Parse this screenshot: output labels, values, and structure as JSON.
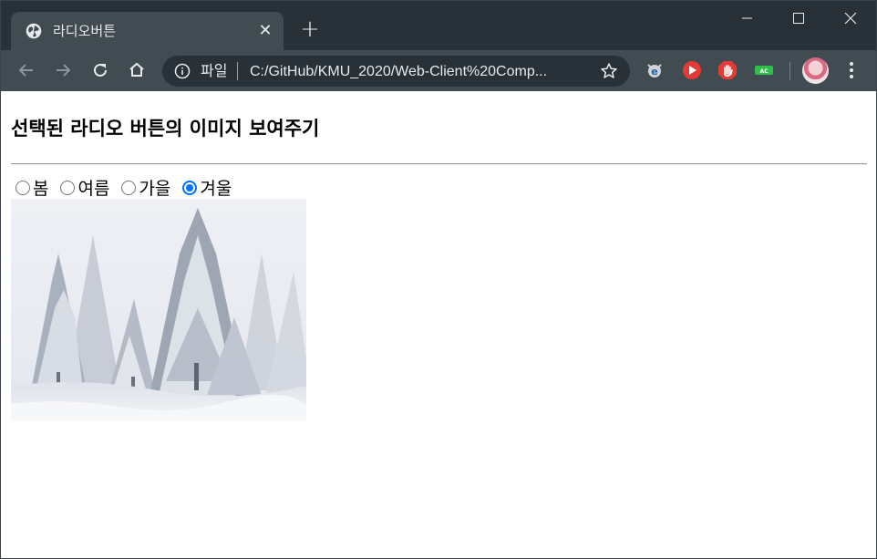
{
  "browser": {
    "tab_title": "라디오버튼",
    "scheme_label": "파일",
    "url": "C:/GitHub/KMU_2020/Web-Client%20Comp..."
  },
  "page": {
    "heading": "선택된 라디오 버튼의 이미지 보여주기",
    "radios": [
      {
        "label": "봄",
        "checked": false
      },
      {
        "label": "여름",
        "checked": false
      },
      {
        "label": "가을",
        "checked": false
      },
      {
        "label": "겨울",
        "checked": true
      }
    ],
    "image": {
      "subject": "snow-covered-forest"
    }
  },
  "colors": {
    "titlebar": "#283137",
    "toolbar": "#414b52",
    "radio_accent": "#0075ff"
  }
}
